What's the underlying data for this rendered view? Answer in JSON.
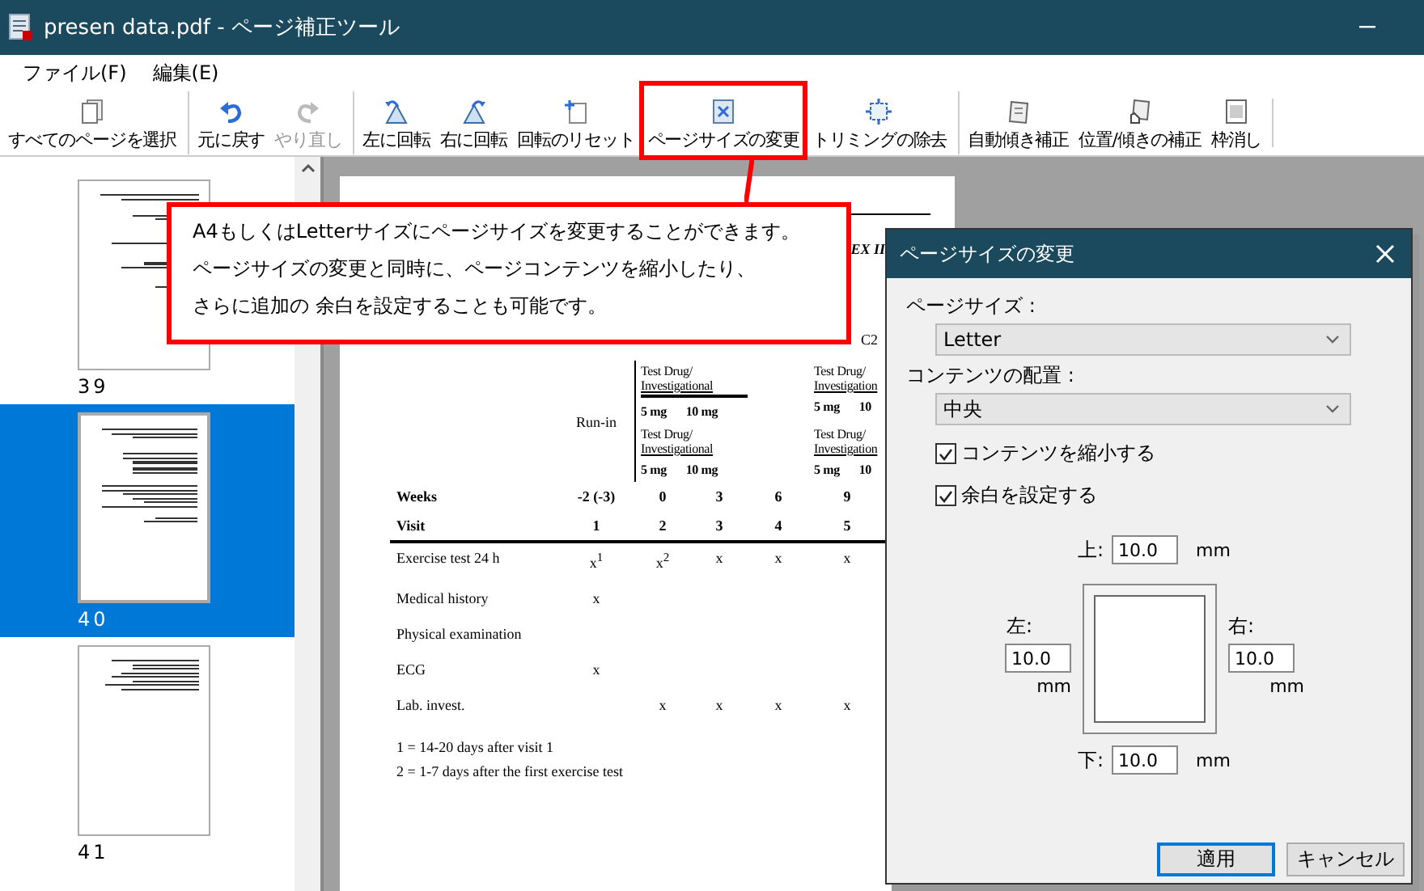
{
  "window": {
    "title": "presen data.pdf - ページ補正ツール"
  },
  "menu": [
    {
      "label": "ファイル(F)"
    },
    {
      "label": "編集(E)"
    }
  ],
  "toolbar": {
    "items": [
      {
        "label": "すべてのページを選択",
        "disabled": false,
        "highlighted": false,
        "separator_before": false
      },
      {
        "label": "元に戻す",
        "disabled": false,
        "highlighted": false,
        "separator_before": true
      },
      {
        "label": "やり直し",
        "disabled": true,
        "highlighted": false,
        "separator_before": false
      },
      {
        "label": "左に回転",
        "disabled": false,
        "highlighted": false,
        "separator_before": true
      },
      {
        "label": "右に回転",
        "disabled": false,
        "highlighted": false,
        "separator_before": false
      },
      {
        "label": "回転のリセット",
        "disabled": false,
        "highlighted": false,
        "separator_before": false
      },
      {
        "label": "ページサイズの変更",
        "disabled": false,
        "highlighted": true,
        "separator_before": false
      },
      {
        "label": "トリミングの除去",
        "disabled": false,
        "highlighted": false,
        "separator_before": false
      },
      {
        "label": "自動傾き補正",
        "disabled": false,
        "highlighted": false,
        "separator_before": true
      },
      {
        "label": "位置/傾きの補正",
        "disabled": false,
        "highlighted": false,
        "separator_before": false
      },
      {
        "label": "枠消し",
        "disabled": false,
        "highlighted": false,
        "separator_before": false
      }
    ]
  },
  "thumbnails": [
    {
      "label": "39",
      "kind": "form",
      "selected": false
    },
    {
      "label": "40",
      "kind": "table",
      "selected": true
    },
    {
      "label": "41",
      "kind": "text",
      "selected": false
    }
  ],
  "document": {
    "corner_text": "EX II",
    "arm_header": "C2",
    "run_in": "Run-in",
    "dose_blocks": [
      [
        {
          "line1": "Test Drug/",
          "line2": "Investigational",
          "doses": [
            "5 mg",
            "10 mg"
          ]
        },
        {
          "line1": "Test Drug/",
          "line2": "Investigation",
          "doses": [
            "5 mg",
            "10"
          ]
        }
      ],
      [
        {
          "line1": "Test Drug/",
          "line2": "Investigational",
          "doses": [
            "5 mg",
            "10 mg"
          ]
        },
        {
          "line1": "Test Drug/",
          "line2": "Investigation",
          "doses": [
            "5 mg",
            "10"
          ]
        }
      ]
    ],
    "rows": [
      {
        "label": "Weeks",
        "kind": "header",
        "cells": [
          "-2 (-3)",
          "0",
          "3",
          "6",
          "9"
        ]
      },
      {
        "label": "Visit",
        "kind": "header",
        "cells": [
          "1",
          "2",
          "3",
          "4",
          "5"
        ]
      },
      {
        "label": "Exercise test 24 h",
        "kind": "body",
        "cells": [
          "x$^{1}$",
          "x$^{2}$",
          "x",
          "x",
          "x"
        ]
      },
      {
        "label": "Medical history",
        "kind": "body",
        "cells": [
          "x",
          null,
          null,
          null,
          null
        ]
      },
      {
        "label": "Physical examination",
        "kind": "body",
        "cells": [
          null,
          null,
          null,
          null,
          null
        ]
      },
      {
        "label": "ECG",
        "kind": "body",
        "cells": [
          "x",
          null,
          null,
          null,
          null
        ]
      },
      {
        "label": "Lab. invest.",
        "kind": "body",
        "cells": [
          null,
          "x",
          "x",
          "x",
          "x"
        ]
      }
    ],
    "footnotes": [
      "1 = 14-20 days after visit 1",
      "2 = 1-7 days after the first exercise test"
    ]
  },
  "callout": {
    "lines": [
      "A4もしくはLetterサイズにページサイズを変更することができます。",
      "ページサイズの変更と同時に、ページコンテンツを縮小したり、",
      "さらに追加の 余白を設定することも可能です。"
    ]
  },
  "dialog": {
    "title": "ページサイズの変更",
    "fields": [
      {
        "label": "ページサイズ :",
        "value": "Letter"
      },
      {
        "label": "コンテンツの配置 :",
        "value": "中央"
      }
    ],
    "checkboxes": [
      {
        "label": "コンテンツを縮小する",
        "checked": true
      },
      {
        "label": "余白を設定する",
        "checked": true
      }
    ],
    "margins": {
      "top": {
        "label": "上:",
        "value": "10.0",
        "unit": "mm"
      },
      "left": {
        "label": "左:",
        "value": "10.0",
        "unit": "mm"
      },
      "right": {
        "label": "右:",
        "value": "10.0",
        "unit": "mm"
      },
      "bottom": {
        "label": "下:",
        "value": "10.0",
        "unit": "mm"
      }
    },
    "buttons": [
      {
        "label": "適用",
        "default": true
      },
      {
        "label": "キャンセル",
        "default": false
      }
    ]
  }
}
